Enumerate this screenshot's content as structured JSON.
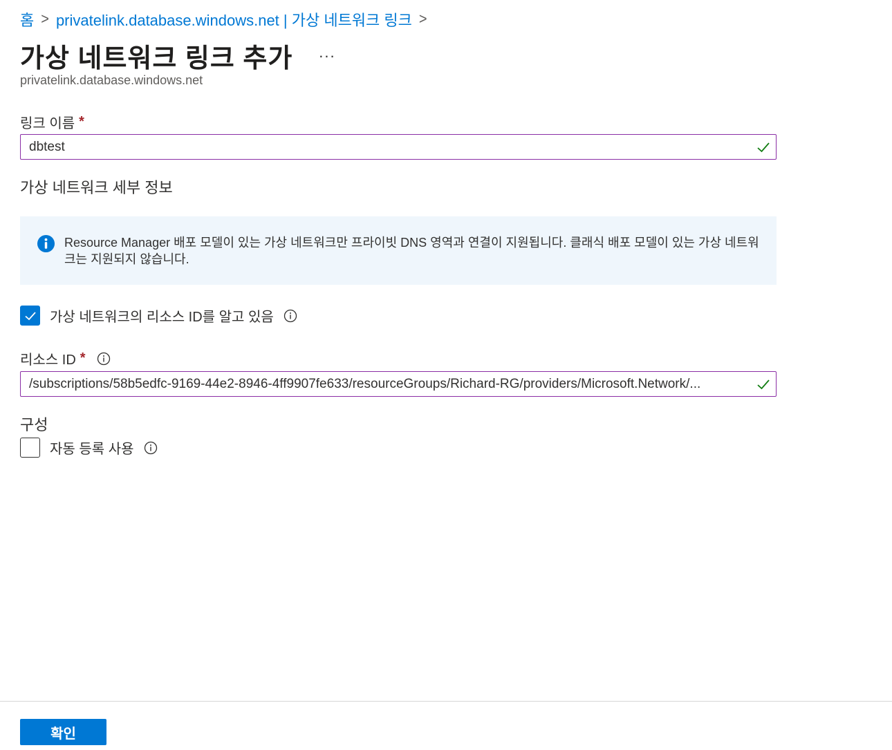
{
  "breadcrumb": {
    "home": "홈",
    "parent": "privatelink.database.windows.net | 가상 네트워크 링크"
  },
  "header": {
    "title": "가상 네트워크 링크 추가",
    "more": "...",
    "subtitle": "privatelink.database.windows.net"
  },
  "link_name": {
    "label": "링크 이름",
    "required_mark": "*",
    "value": "dbtest"
  },
  "vnet_details": {
    "heading": "가상 네트워크 세부 정보",
    "info_message": "Resource Manager 배포 모델이 있는 가상 네트워크만 프라이빗 DNS 영역과 연결이 지원됩니다. 클래식 배포 모델이 있는 가상 네트워크는 지원되지 않습니다.",
    "know_resource_id": {
      "label": "가상 네트워크의 리소스 ID를 알고 있음",
      "checked": true
    }
  },
  "resource_id": {
    "label": "리소스 ID",
    "required_mark": "*",
    "value": "/subscriptions/58b5edfc-9169-44e2-8946-4ff9907fe633/resourceGroups/Richard-RG/providers/Microsoft.Network/..."
  },
  "configuration": {
    "heading": "구성",
    "auto_registration": {
      "label": "자동 등록 사용",
      "checked": false
    }
  },
  "footer": {
    "confirm_label": "확인"
  },
  "colors": {
    "accent": "#0078d4",
    "input_border": "#8a2da5",
    "valid_check": "#107c10",
    "required": "#a4262c",
    "info_background": "#eff6fc"
  }
}
